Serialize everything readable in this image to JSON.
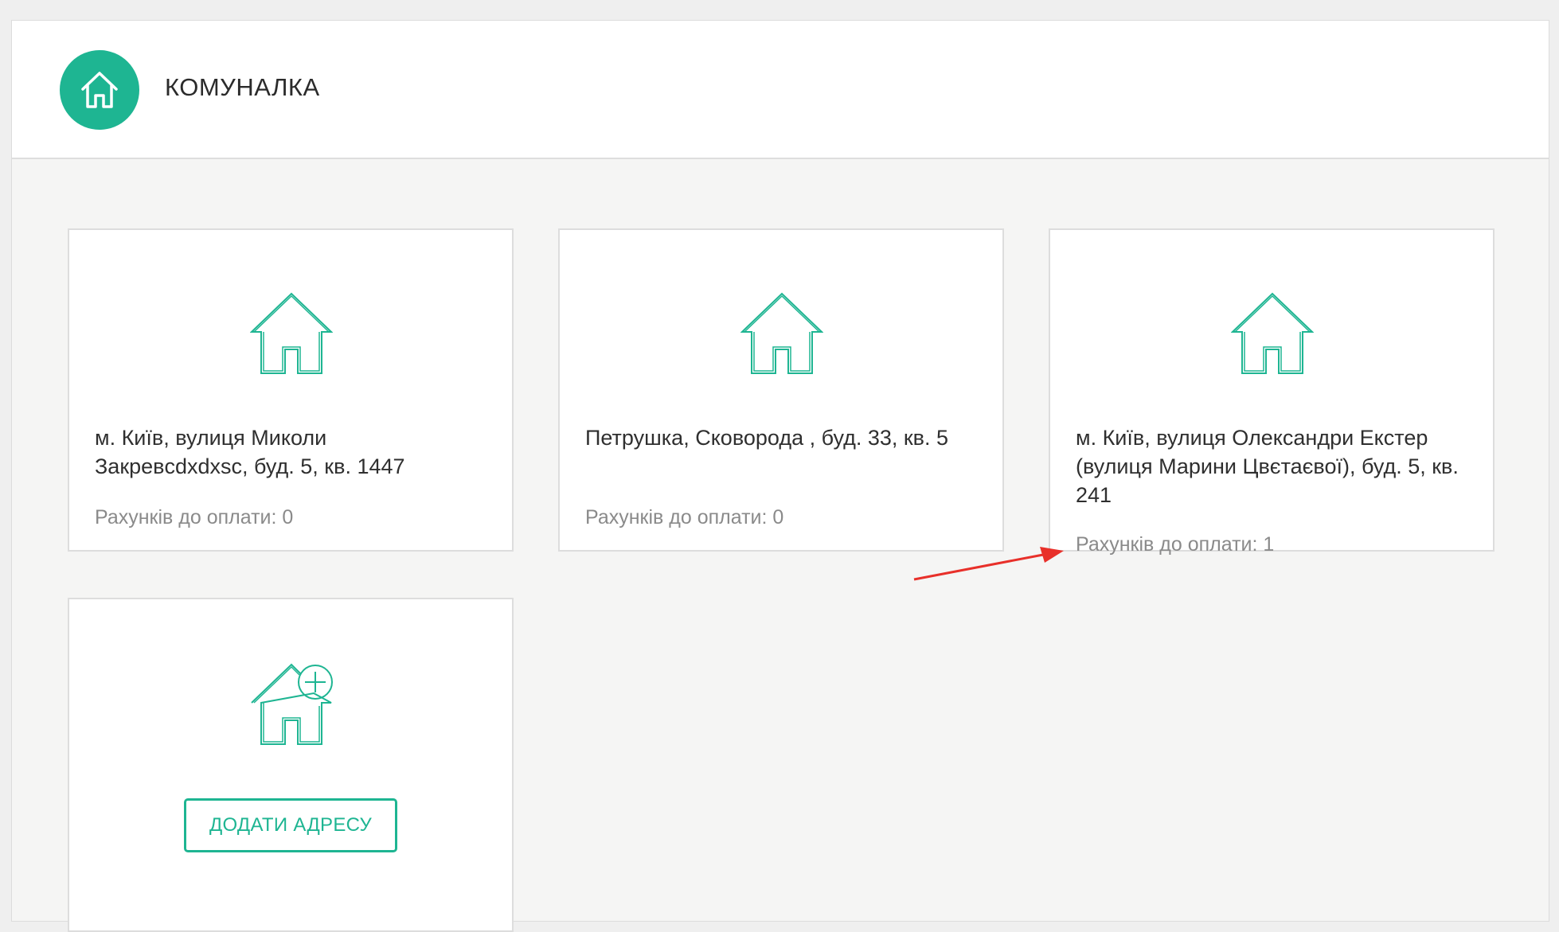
{
  "header": {
    "title": "КОМУНАЛКА",
    "logo_icon": "home-icon",
    "accent_color": "#1eb592"
  },
  "addresses": [
    {
      "address": "м. Київ, вулиця Миколи Закревcdxdxsc, буд. 5, кв. 1447",
      "bills_label": "Рахунків до оплати: 0",
      "icon": "house-outline-icon"
    },
    {
      "address": "Петрушка, Сковорода , буд. 33, кв. 5",
      "bills_label": "Рахунків до оплати: 0",
      "icon": "house-outline-icon"
    },
    {
      "address": "м. Київ, вулиця Олександри Екстер (вулиця Марини Цвєтаєвої), буд. 5, кв. 241",
      "bills_label": "Рахунків до оплати: 1",
      "icon": "house-outline-icon"
    }
  ],
  "add_card": {
    "icon": "house-add-icon",
    "button_label": "ДОДАТИ АДРЕСУ"
  },
  "annotation": {
    "color": "#e8302a"
  }
}
